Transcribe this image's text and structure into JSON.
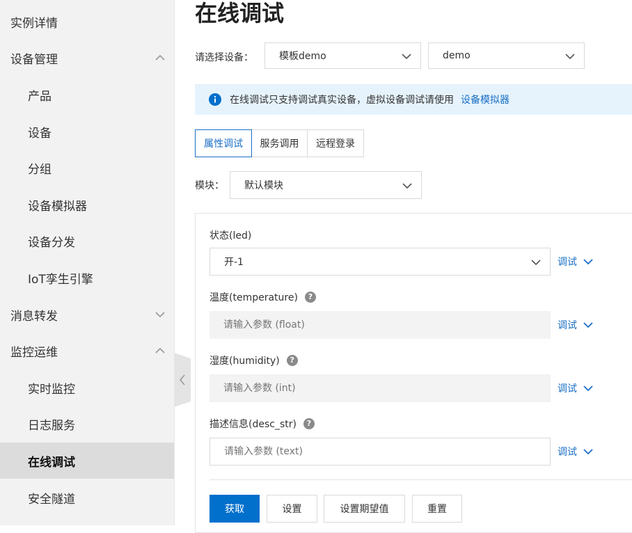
{
  "sidebar": {
    "items": [
      {
        "label": "实例详情"
      },
      {
        "label": "设备管理"
      },
      {
        "label": "产品"
      },
      {
        "label": "设备"
      },
      {
        "label": "分组"
      },
      {
        "label": "设备模拟器"
      },
      {
        "label": "设备分发"
      },
      {
        "label": "IoT孪生引擎"
      },
      {
        "label": "消息转发"
      },
      {
        "label": "监控运维"
      },
      {
        "label": "实时监控"
      },
      {
        "label": "日志服务"
      },
      {
        "label": "在线调试"
      },
      {
        "label": "安全隧道"
      }
    ]
  },
  "main": {
    "title": "在线调试",
    "device_label": "请选择设备：",
    "product_select": "模板demo",
    "device_select": "demo",
    "notice": {
      "text": "在线调试只支持调试真实设备，虚拟设备调试请使用",
      "link": "设备模拟器"
    },
    "tabs": [
      {
        "label": "属性调试"
      },
      {
        "label": "服务调用"
      },
      {
        "label": "远程登录"
      }
    ],
    "module_label": "模块：",
    "module_select": "默认模块",
    "fields": [
      {
        "label": "状态(led)",
        "value": "开-1",
        "debug": "调试"
      },
      {
        "label": "温度(temperature)",
        "placeholder": "请输入参数 (float)",
        "debug": "调试"
      },
      {
        "label": "湿度(humidity)",
        "placeholder": "请输入参数 (int)",
        "debug": "调试"
      },
      {
        "label": "描述信息(desc_str)",
        "placeholder": "请输入参数 (text)",
        "debug": "调试"
      }
    ],
    "buttons": {
      "get": "获取",
      "set": "设置",
      "set_expected": "设置期望值",
      "reset": "重置"
    }
  },
  "colors": {
    "accent": "#0070cc",
    "link": "#1a6fc4",
    "notice_bg": "#e6f3fc",
    "sidebar_bg": "#f2f2f2",
    "active_item_bg": "#dcdcdc"
  }
}
